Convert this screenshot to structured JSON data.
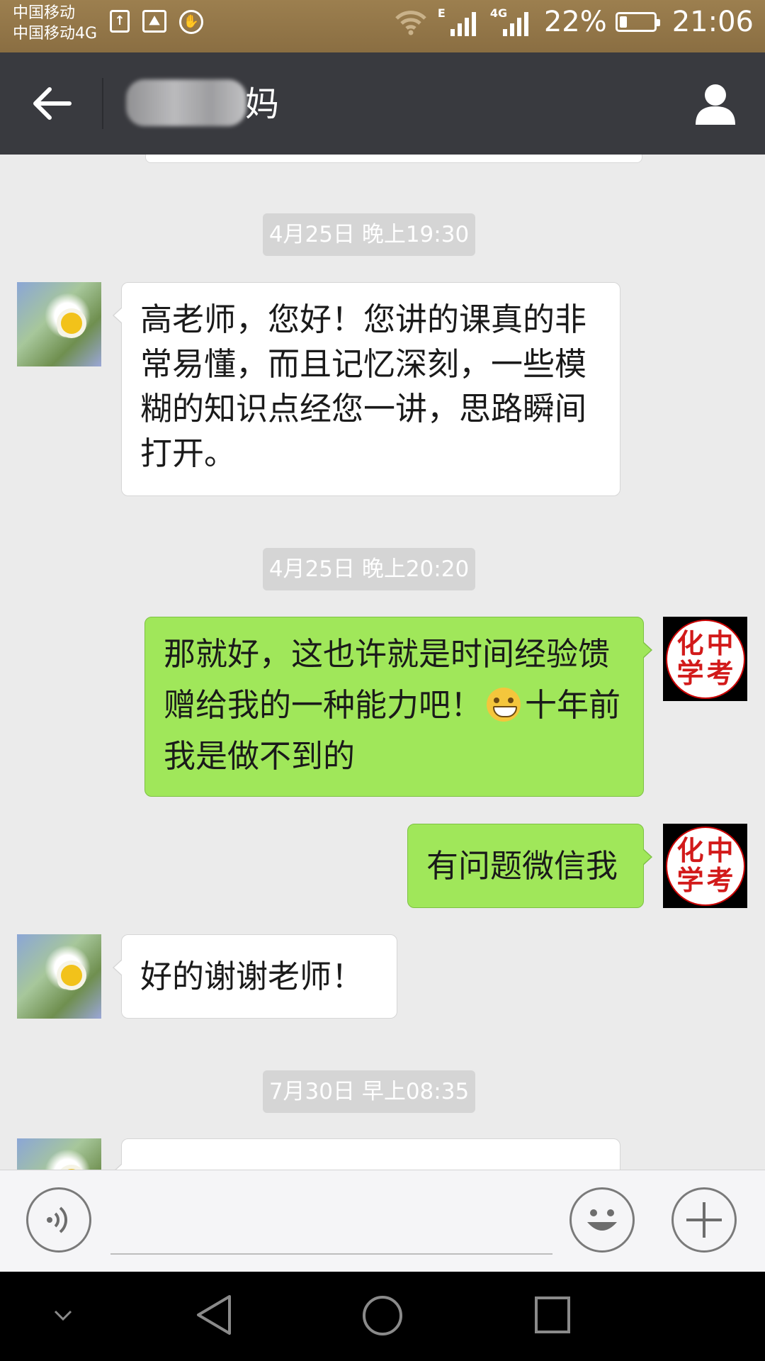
{
  "status_bar": {
    "carrier_line1": "中国移动",
    "carrier_line2": "中国移动4G",
    "network_tag_1": "E",
    "network_tag_2": "4G",
    "battery": "22%",
    "battery_level": 0.22,
    "time": "21:06"
  },
  "header": {
    "title_visible_suffix": "妈",
    "back_icon": "arrow-left-icon",
    "profile_icon": "person-icon"
  },
  "messages": [
    {
      "type": "timestamp",
      "text": "4月25日 晚上19:30"
    },
    {
      "type": "incoming",
      "text": "高老师，您好！您讲的课真的非常易懂，而且记忆深刻，一些模糊的知识点经您一讲，思路瞬间打开。"
    },
    {
      "type": "timestamp",
      "text": "4月25日 晚上20:20"
    },
    {
      "type": "outgoing",
      "text_before_emoji": "那就好，这也许就是时间经验馈赠给我的一种能力吧！",
      "emoji": "grin-emoji",
      "text_after_emoji": "十年前我是做不到的"
    },
    {
      "type": "outgoing",
      "text": "有问题微信我"
    },
    {
      "type": "incoming",
      "text": "好的谢谢老师！"
    },
    {
      "type": "timestamp",
      "text": "7月30日 早上08:35"
    }
  ],
  "avatar_self_chars": [
    "中",
    "化",
    "考",
    "学"
  ],
  "input_bar": {
    "voice_icon": "voice-icon",
    "emoji_icon": "smiley-icon",
    "plus_icon": "plus-icon"
  },
  "colors": {
    "status_bar": "#8f7346",
    "title_bar": "#393a3f",
    "chat_bg": "#ebebeb",
    "outgoing_bubble": "#a0e75a",
    "incoming_bubble": "#ffffff",
    "timestamp_bg": "#d5d5d5"
  }
}
